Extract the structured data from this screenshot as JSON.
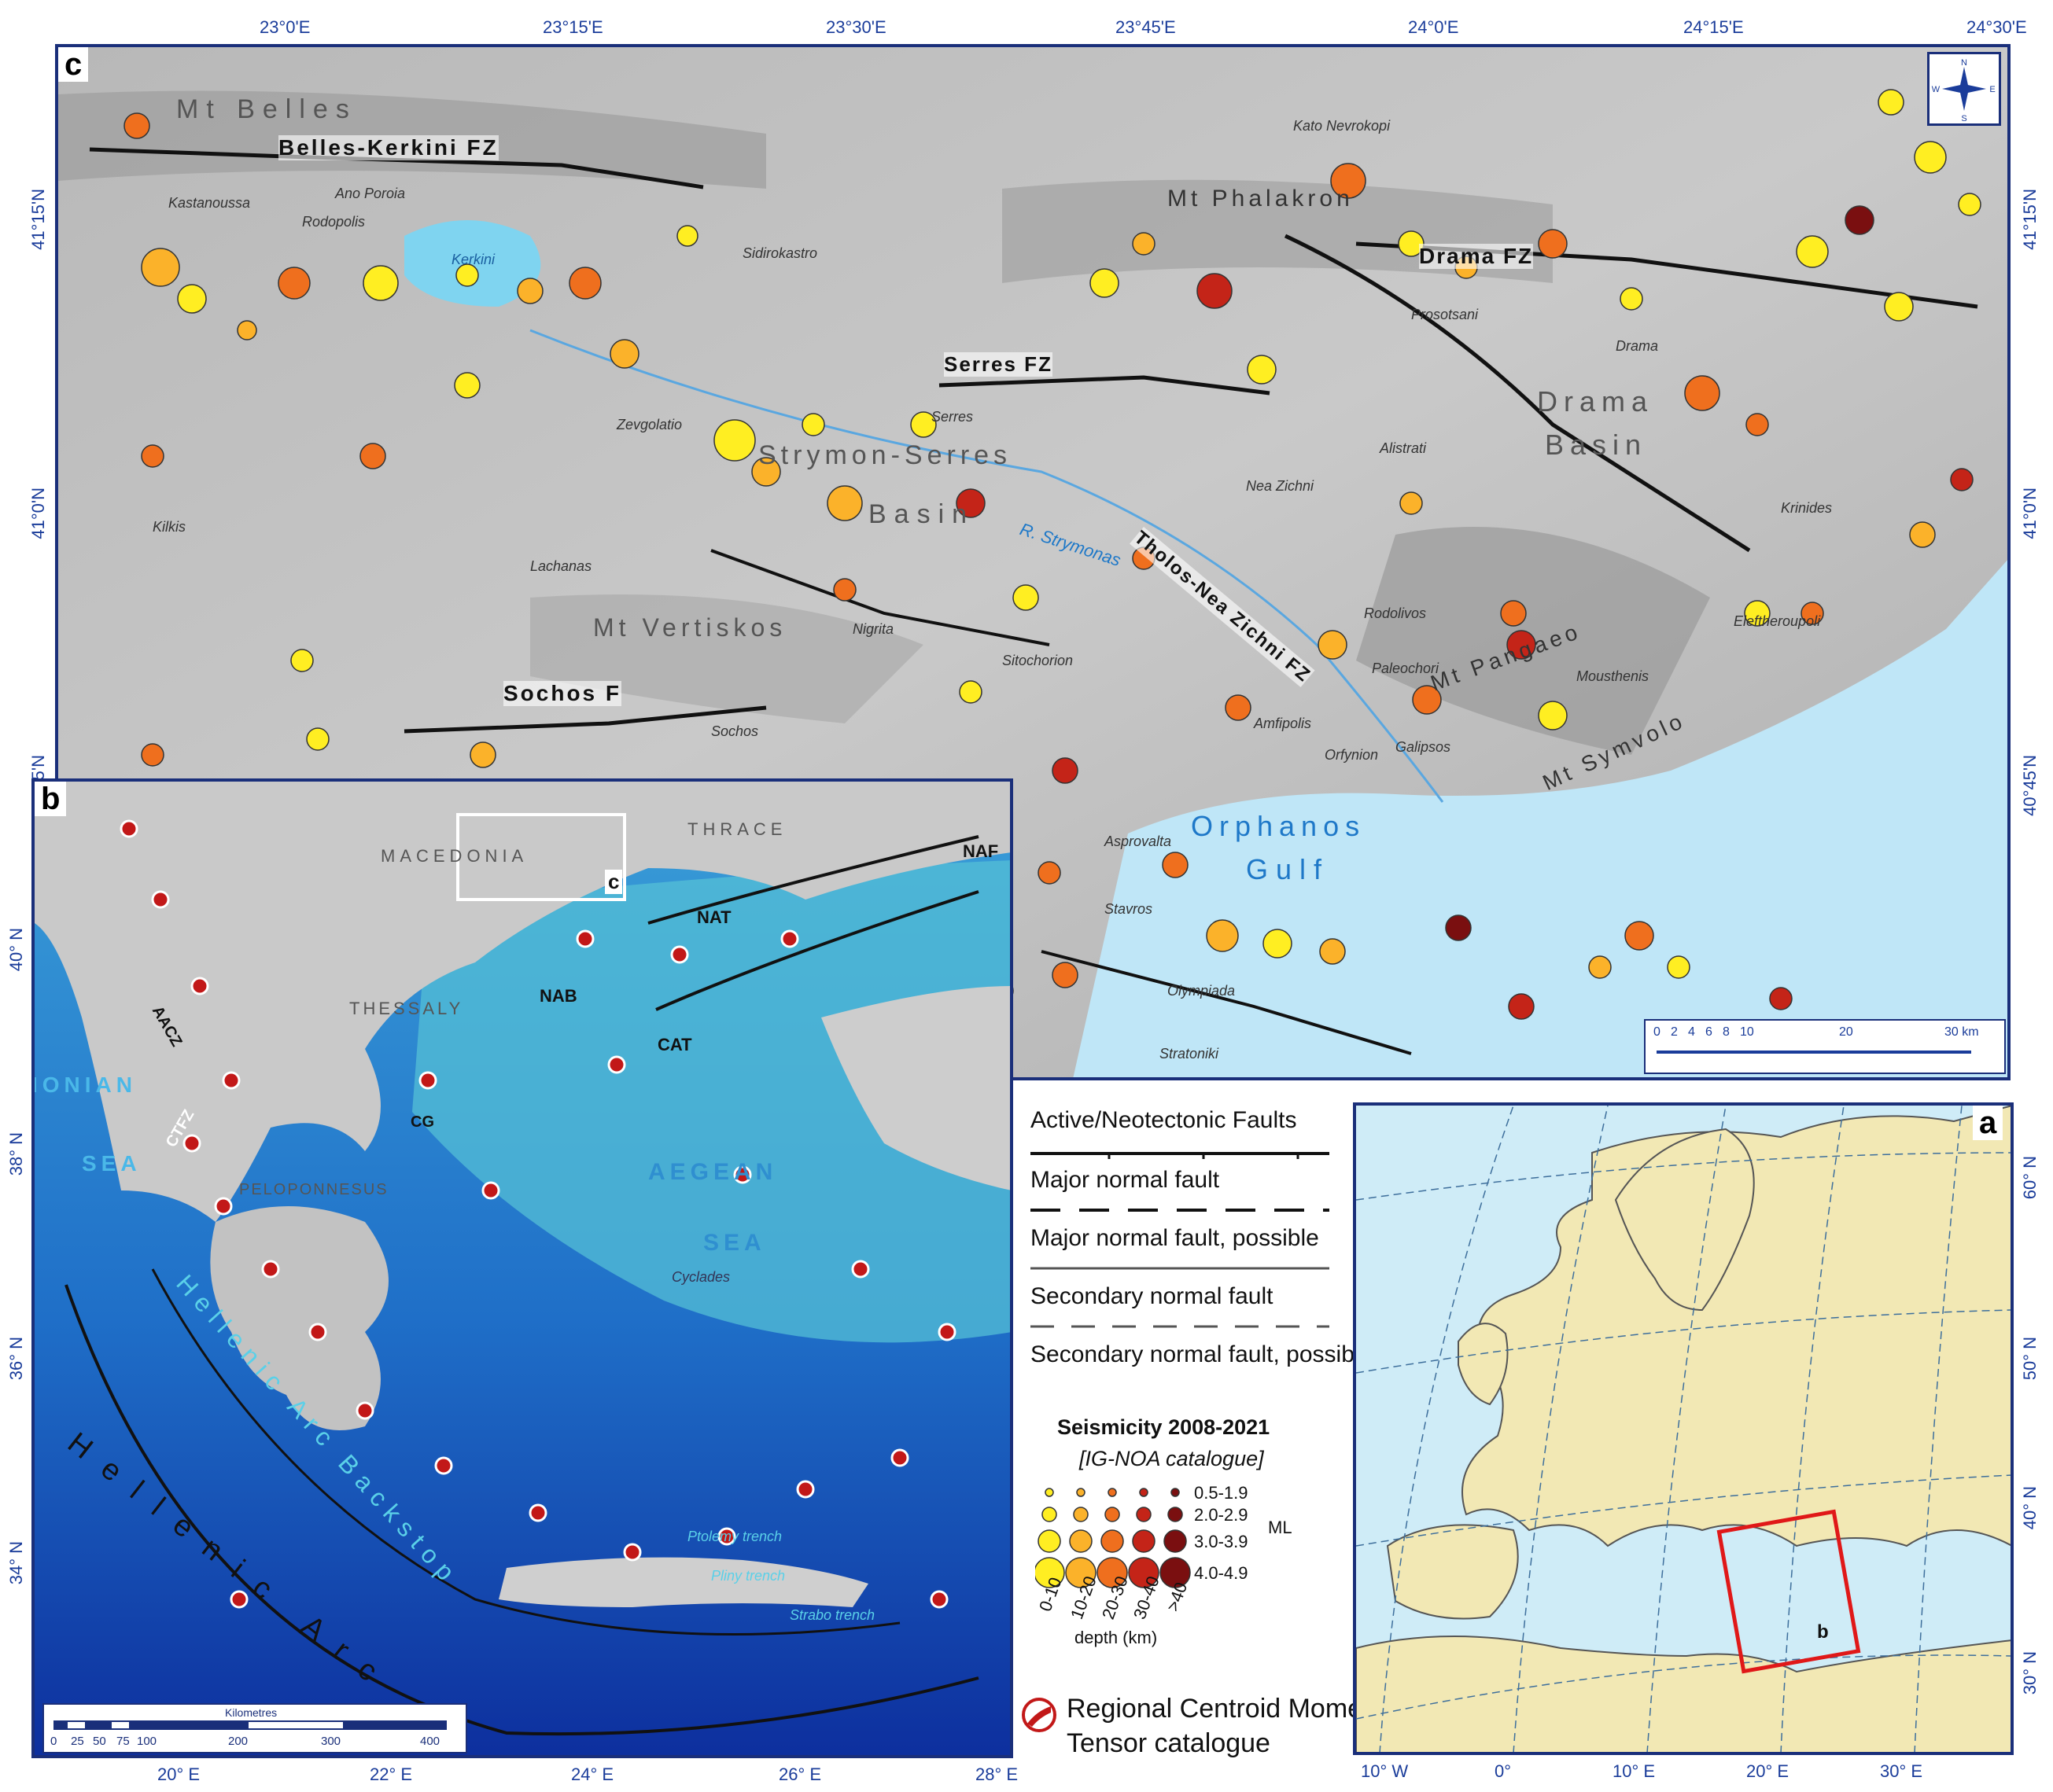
{
  "panel_c": {
    "letter": "c",
    "top_lon_ticks": [
      "23°0'E",
      "23°15'E",
      "23°30'E",
      "23°45'E",
      "24°0'E",
      "24°15'E",
      "24°30'E"
    ],
    "left_lat_ticks": [
      "41°15'N",
      "41°0'N",
      "40°45'N"
    ],
    "right_lat_ticks": [
      "41°15'N",
      "41°0'N",
      "40°45'N"
    ],
    "fault_labels": [
      "Belles-Kerkini FZ",
      "Serres FZ",
      "Drama FZ",
      "Tholos-Nea Zichni FZ",
      "Sochos F"
    ],
    "region_labels": [
      "Mt Belles",
      "Mt Vertiskos",
      "Strymon-Serres",
      "Basin",
      "Drama",
      "Basin",
      "Mt Phalakron",
      "Mt Pangaeo",
      "Mt Symvolo"
    ],
    "town_labels": [
      "Kastanoussa",
      "Ano Poroia",
      "Rodopolis",
      "Sidirokastro",
      "Kato Nevrokopi",
      "Prosotsani",
      "Drama",
      "Serres",
      "Zevgolatio",
      "Nea Zichni",
      "Alistrati",
      "Krinides",
      "Kilkis",
      "Lachanas",
      "Nigrita",
      "Sitochorion",
      "Rodolivos",
      "Eleftheroupoli",
      "Paleochori",
      "Mousthenis",
      "Amfipolis",
      "Galipsos",
      "Orfynion",
      "Sochos",
      "Asprovalta",
      "Stavros",
      "Olympiada",
      "Stratoniki",
      "Kerkini"
    ],
    "water_labels": [
      "Orphanos",
      "Gulf",
      "R. Strymonas"
    ],
    "scale_ticks": [
      "0",
      "2",
      "4",
      "6",
      "8",
      "10",
      "20",
      "30 km"
    ],
    "compass": [
      "N",
      "S",
      "E",
      "W"
    ]
  },
  "panel_b": {
    "letter": "b",
    "bottom_lon_ticks": [
      "20° E",
      "22° E",
      "24° E",
      "26° E",
      "28° E"
    ],
    "left_lat_ticks": [
      "40° N",
      "38° N",
      "36° N",
      "34° N"
    ],
    "region_labels": [
      "MACEDONIA",
      "THRACE",
      "THESSALY",
      "PELOPONNESUS",
      "IONIAN",
      "SEA",
      "AEGEAN",
      "SEA",
      "Cyclades"
    ],
    "fault_labels": [
      "NAF",
      "NAT",
      "NAB",
      "CAT",
      "AACZ",
      "CTFZ",
      "CG"
    ],
    "arc_labels": [
      "Hellenic Arc",
      "Hellenic Arc Backstop",
      "Ptolemy trench",
      "Pliny trench",
      "Strabo trench"
    ],
    "inset_label": "c",
    "scale_title": "Kilometres",
    "scale_ticks": [
      "0",
      "25",
      "50",
      "75",
      "100",
      "200",
      "300",
      "400"
    ]
  },
  "legend": {
    "faults_title": "Active/Neotectonic Faults",
    "fault_types": [
      "Major normal fault",
      "Major normal fault, possible",
      "Secondary normal fault",
      "Secondary normal fault, possible"
    ],
    "seis_title": "Seismicity 2008-2021",
    "seis_subtitle": "[IG-NOA catalogue]",
    "mag_classes": [
      "0.5-1.9",
      "2.0-2.9",
      "3.0-3.9",
      "4.0-4.9"
    ],
    "mag_symbol": "ML",
    "depth_classes": [
      "0-10",
      "10-20",
      "20-30",
      "30-40",
      ">40"
    ],
    "depth_title": "depth (km)",
    "depth_colors": [
      "#ffee22",
      "#fbb22a",
      "#ef6f1e",
      "#c42418",
      "#7a0f10"
    ],
    "cmt_line1": "Regional Centroid Moment",
    "cmt_line2": "Tensor catalogue"
  },
  "panel_a": {
    "letter": "a",
    "bottom_lon_ticks": [
      "10° W",
      "0°",
      "10° E",
      "20° E",
      "30° E"
    ],
    "right_lat_ticks": [
      "60° N",
      "50° N",
      "40° N",
      "30° N"
    ],
    "box_label": "b"
  }
}
